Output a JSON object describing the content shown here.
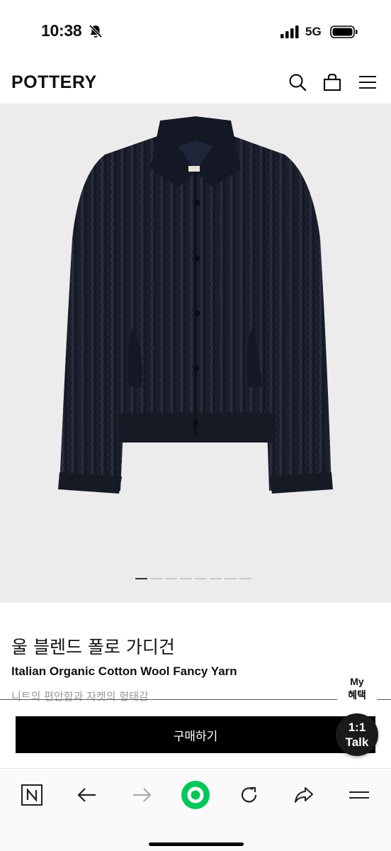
{
  "status_bar": {
    "time": "10:38",
    "network": "5G",
    "icons": [
      "bell-off-icon",
      "signal-icon",
      "battery-icon"
    ]
  },
  "header": {
    "logo": "POTTERY",
    "icons": [
      "search-icon",
      "shopping-bag-icon",
      "menu-icon"
    ]
  },
  "gallery": {
    "image": "navy ribbed knit polo cardigan with buttons and side pockets",
    "slide_count": 8,
    "active_slide": 1
  },
  "product": {
    "title_kr": "울 블렌드 폴로 가디건",
    "title_en": "Italian Organic Cotton Wool Fancy Yarn",
    "description": "니트의 편안함과 자켓의 형태감"
  },
  "my_benefit": {
    "line1": "My",
    "line2": "혜택"
  },
  "buy_button": {
    "label": "구매하기"
  },
  "talk_button": {
    "line1": "1:1",
    "line2": "Talk"
  },
  "browser_nav": {
    "icons": [
      "naver-icon",
      "back-arrow-icon",
      "forward-arrow-icon",
      "green-home-icon",
      "refresh-icon",
      "share-icon",
      "menu-icon"
    ]
  },
  "colors": {
    "accent_green": "#03c75a",
    "garment_navy": "#1b1f2b",
    "hero_bg": "#ececec"
  }
}
